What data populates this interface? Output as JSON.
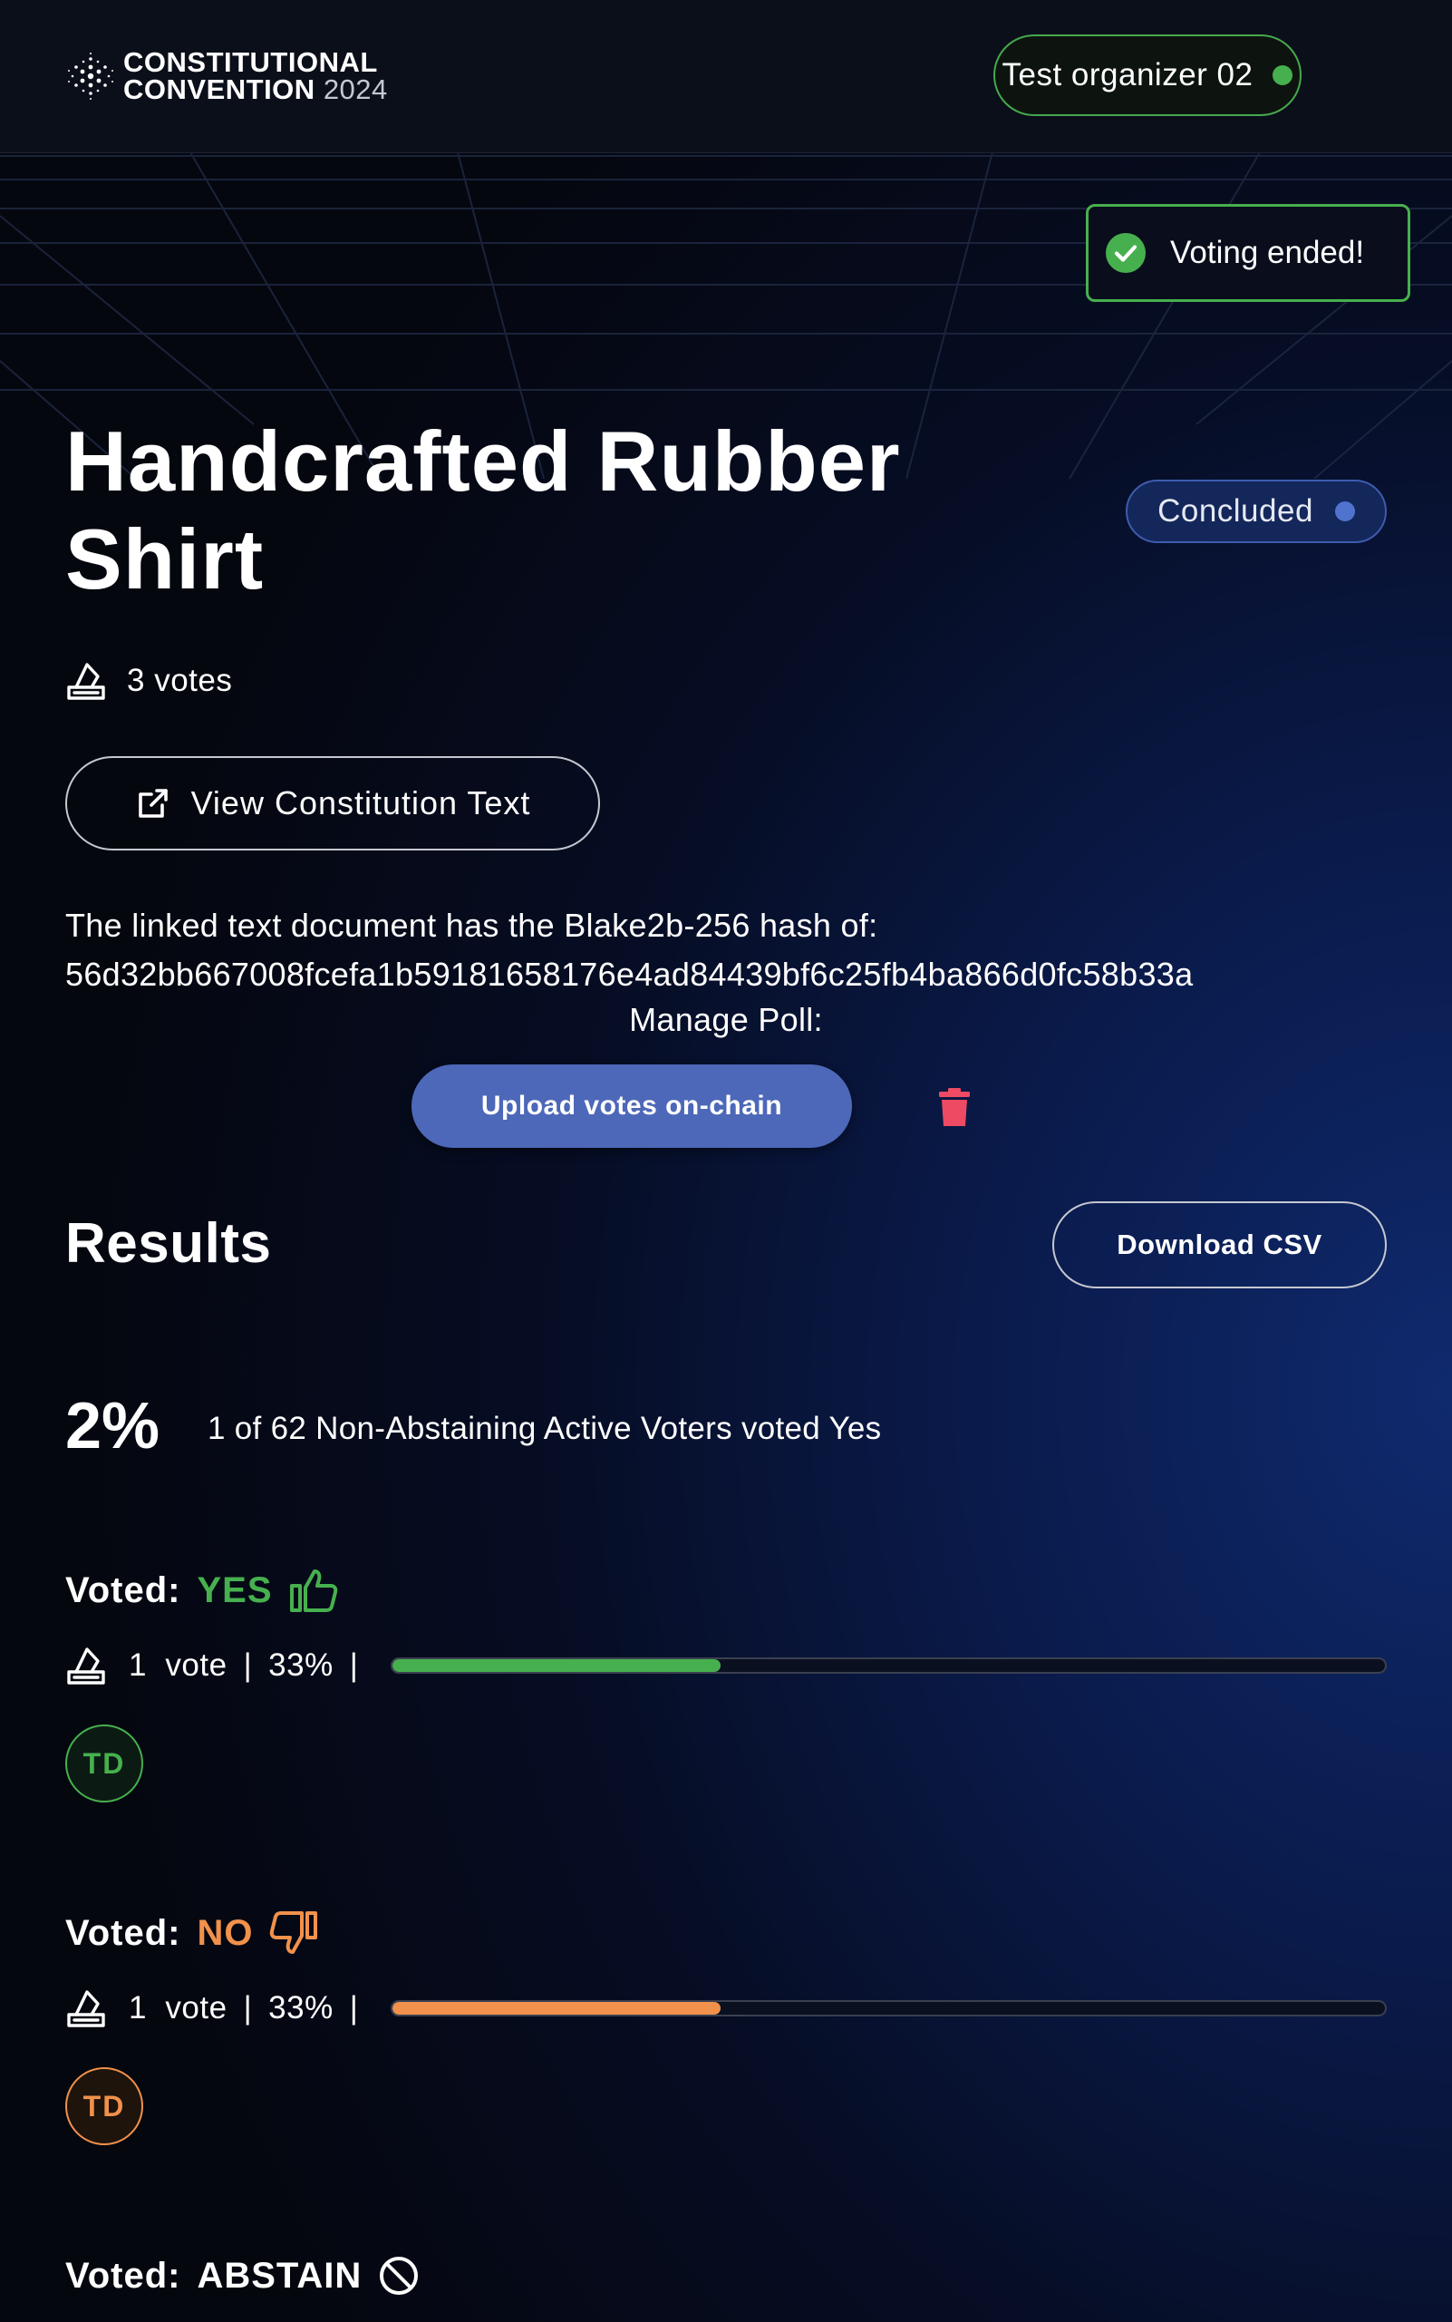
{
  "header": {
    "logo_line1": "CONSTITUTIONAL",
    "logo_line2": "CONVENTION",
    "logo_year": "2024",
    "user_name": "Test organizer 02",
    "user_status_color": "#47b04e"
  },
  "toast": {
    "message": "Voting ended!",
    "icon": "check-circle-icon"
  },
  "poll": {
    "title": "Handcrafted Rubber Shirt",
    "status": "Concluded",
    "vote_count_label": "3 votes",
    "view_button_label": "View Constitution Text",
    "hash_intro": "The linked text document has the Blake2b-256 hash of:",
    "hash_value": "56d32bb667008fcefa1b59181658176e4ad84439bf6c25fb4ba866d0fc58b33a",
    "manage_label": "Manage Poll:",
    "upload_button_label": "Upload votes on-chain"
  },
  "results": {
    "title": "Results",
    "download_label": "Download CSV",
    "summary_pct": "2%",
    "summary_text": "1 of 62 Non-Abstaining Active Voters voted Yes",
    "sections": [
      {
        "label": "Voted:",
        "choice": "YES",
        "color": "#47b04e",
        "icon": "thumbs-up-icon",
        "votes": "1",
        "vote_word": "vote",
        "pct": "33%",
        "fraction": 0.33,
        "avatar": "TD"
      },
      {
        "label": "Voted:",
        "choice": "NO",
        "color": "#f1914b",
        "icon": "thumbs-down-icon",
        "votes": "1",
        "vote_word": "vote",
        "pct": "33%",
        "fraction": 0.33,
        "avatar": "TD"
      },
      {
        "label": "Voted:",
        "choice": "ABSTAIN",
        "color": "#ffffff",
        "icon": "prohibited-icon"
      }
    ]
  }
}
